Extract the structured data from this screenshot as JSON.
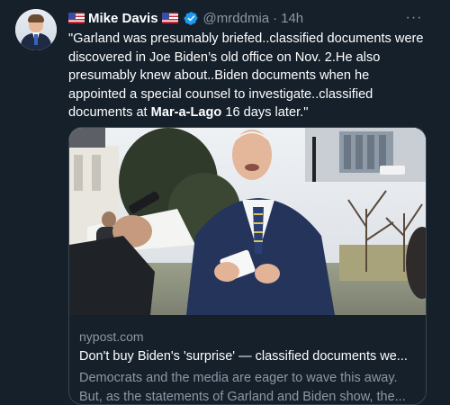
{
  "tweet": {
    "author": {
      "name": "Mike Davis",
      "handle": "@mrddmia",
      "verified": true,
      "flag_icon": "us-flag-icon"
    },
    "separator": "·",
    "time": "14h",
    "more_label": "···",
    "text": {
      "part1": "\"Garland was presumably briefed..classified documents were discovered in Joe Biden’s old office on Nov. 2.He also presumably knew about..Biden documents when he appointed a special counsel to investigate..classified documents at ",
      "bold": "Mar-a-Lago",
      "part2": " 16 days later.\""
    },
    "card": {
      "domain": "nypost.com",
      "title": "Don't buy Biden's 'surprise' — classified documents we...",
      "description_line1": "Democrats and the media are eager to wave this away.",
      "description_line2": "But, as the statements of Garland and Biden show, the..."
    }
  },
  "colors": {
    "background": "#15202b",
    "text_primary": "#ffffff",
    "text_secondary": "#8b98a5",
    "border": "#38444d",
    "verified_blue": "#1d9bf0"
  }
}
